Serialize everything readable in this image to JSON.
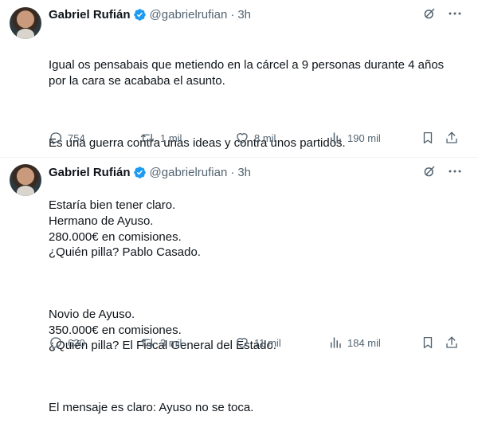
{
  "colors": {
    "text": "#0f1419",
    "muted": "#536471",
    "verified": "#1d9bf0",
    "divider": "#eff3f4"
  },
  "tweets": [
    {
      "author": {
        "name": "Gabriel Rufián",
        "handle": "@gabrielrufian",
        "verified": true
      },
      "time": "3h",
      "paragraphs": [
        [
          "Igual os pensabais que metiendo en la cárcel a 9 personas durante 4 años",
          "por la cara se acababa el asunto."
        ],
        [
          "Es una guerra contra unas ideas y contra unos partidos."
        ],
        [
          "Estaría bien tener claro."
        ]
      ],
      "stats": {
        "replies": "754",
        "reposts": "1 mil",
        "likes": "8 mil",
        "views": "190 mil"
      },
      "icons": [
        "grok-icon",
        "more-icon",
        "reply-icon",
        "repost-icon",
        "like-icon",
        "views-icon",
        "bookmark-icon",
        "share-icon"
      ]
    },
    {
      "author": {
        "name": "Gabriel Rufián",
        "handle": "@gabrielrufian",
        "verified": true
      },
      "time": "3h",
      "paragraphs": [
        [
          "Hermano de Ayuso.",
          "280.000€ en comisiones.",
          "¿Quién pilla? Pablo Casado."
        ],
        [
          "Novio de Ayuso.",
          "350.000€ en comisiones.",
          "¿Quién pilla? El Fiscal General del Estado."
        ],
        [
          "El mensaje es claro: Ayuso no se toca."
        ]
      ],
      "stats": {
        "replies": "630",
        "reposts": "3 mil",
        "likes": "11 mil",
        "views": "184 mil"
      },
      "icons": [
        "grok-icon",
        "more-icon",
        "reply-icon",
        "repost-icon",
        "like-icon",
        "views-icon",
        "bookmark-icon",
        "share-icon"
      ]
    }
  ]
}
